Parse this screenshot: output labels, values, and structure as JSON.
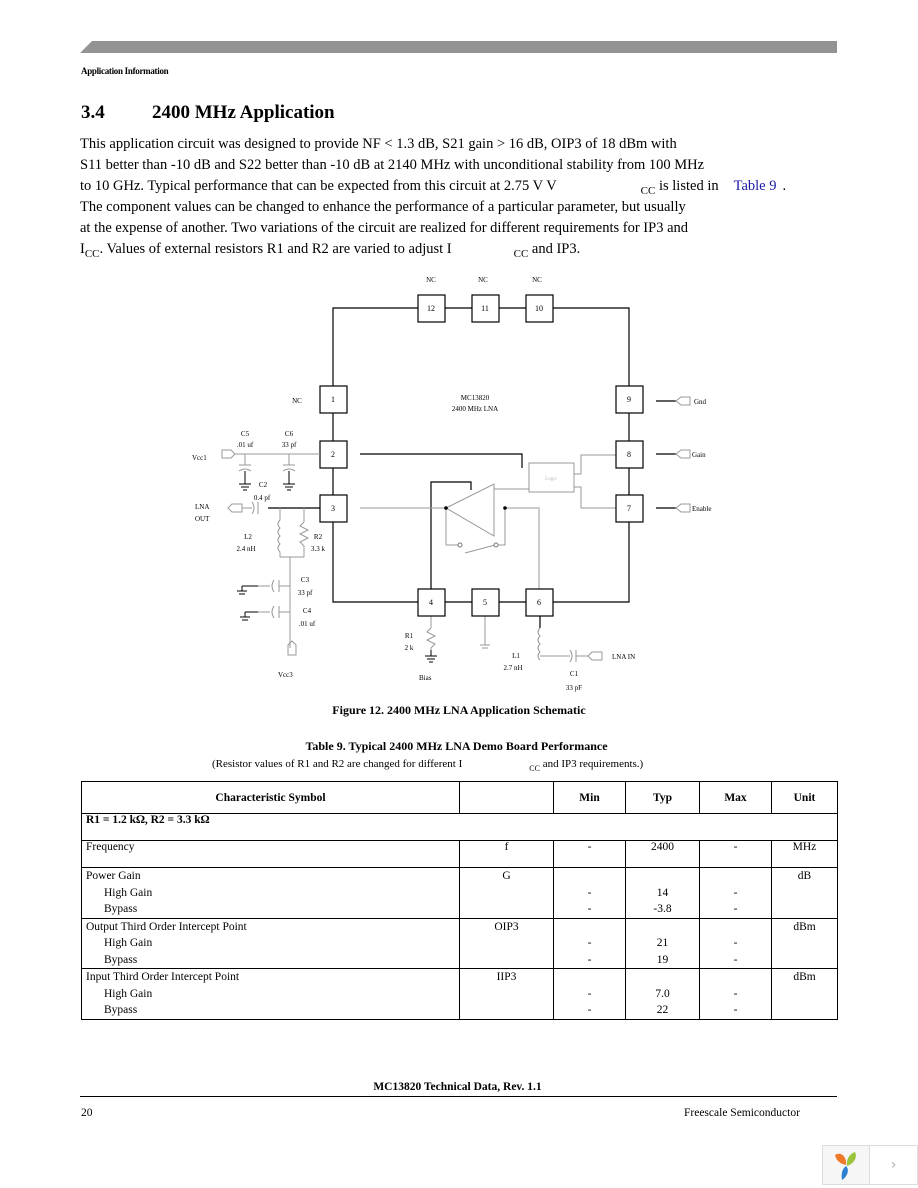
{
  "header": {
    "section_label": "Application Information",
    "bar_color": "#939393"
  },
  "section": {
    "number": "3.4",
    "title": "2400 MHz Application"
  },
  "paragraph": {
    "line1": "This application circuit was designed to provide NF < 1.3 dB, S21 gain > 16 dB, OIP3 of 18 dBm with",
    "line2": "S11 better than -10 dB and S22 better than -10 dB at 2140 MHz with unconditional stability from 100 MHz",
    "line3_a": "to 10 GHz. Typical performance that can be expected from this circuit at 2.75 V V",
    "line3_sub": "CC",
    "line3_b": " is listed in",
    "line3_link": "Table 9",
    "line3_c": ".",
    "line4": "The component values can be changed to enhance the performance of a particular parameter, but usually",
    "line5": "at the expense of another. Two variations of the circuit are realized for different requirements for IP3 and",
    "line6_a": "I",
    "line6_sub": "CC",
    "line6_b": ". Values of external resistors R1 and R2 are varied to adjust I",
    "line6_sub2": "CC",
    "line6_c": " and IP3.",
    "link_color": "#1a1aa6"
  },
  "schematic": {
    "chip_name": "MC13820",
    "chip_desc": "2400 MHz LNA",
    "logic_label": "Logic",
    "pins": [
      "1",
      "2",
      "3",
      "4",
      "5",
      "6",
      "7",
      "8",
      "9",
      "10",
      "11",
      "12"
    ],
    "nc_label": "NC",
    "ports": {
      "vcc1": "Vcc1",
      "vcc3": "Vcc3",
      "lna_out_1": "LNA",
      "lna_out_2": "OUT",
      "lna_in": "LNA IN",
      "gnd": "Gnd",
      "gain": "Gain",
      "enable": "Enable",
      "bias": "Bias"
    },
    "components": {
      "c5_name": "C5",
      "c5_val": ".01 uf",
      "c6_name": "C6",
      "c6_val": "33 pf",
      "c2_name": "C2",
      "c2_val": "0.4 pf",
      "l2_name": "L2",
      "l2_val": "2.4 nH",
      "r2_name": "R2",
      "r2_val": "3.3 k",
      "c3_name": "C3",
      "c3_val": "33 pf",
      "c4_name": "C4",
      "c4_val": ".01 uf",
      "r1_name": "R1",
      "r1_val": "2 k",
      "l1_name": "L1",
      "l1_val": "2.7 nH",
      "c1_name": "C1",
      "c1_val": "33 pF"
    }
  },
  "figure_caption": "Figure 12. 2400 MHz LNA Application Schematic",
  "table": {
    "title": "Table 9. Typical 2400 MHz LNA Demo Board Performance",
    "subtitle_a": "(Resistor values of R1 and R2 are changed for different I",
    "subtitle_sub": "CC",
    "subtitle_b": " and IP3 requirements.)",
    "columns": [
      "Characteristic Symbol",
      "",
      "Min",
      "Typ",
      "Max",
      "Unit"
    ],
    "group_label": "R1 = 1.2 kΩ, R2 = 3.3 kΩ",
    "rows": [
      {
        "characteristic": "Frequency",
        "symbol": "f",
        "min": "-",
        "typ": "2400",
        "max": "-",
        "unit": "MHz"
      },
      {
        "characteristic": "Power Gain",
        "symbol": "G",
        "unit": "dB",
        "sub": [
          {
            "label": "High Gain",
            "min": "-",
            "typ": "14",
            "max": "-"
          },
          {
            "label": "Bypass",
            "min": "-",
            "typ": "-3.8",
            "max": "-"
          }
        ]
      },
      {
        "characteristic": "Output Third Order Intercept Point",
        "symbol": "OIP3",
        "unit": "dBm",
        "sub": [
          {
            "label": "High Gain",
            "min": "-",
            "typ": "21",
            "max": "-"
          },
          {
            "label": "Bypass",
            "min": "-",
            "typ": "19",
            "max": "-"
          }
        ]
      },
      {
        "characteristic": "Input Third Order Intercept Point",
        "symbol": "IIP3",
        "unit": "dBm",
        "sub": [
          {
            "label": "High Gain",
            "min": "-",
            "typ": "7.0",
            "max": "-"
          },
          {
            "label": "Bypass",
            "min": "-",
            "typ": "22",
            "max": "-"
          }
        ]
      }
    ]
  },
  "footer": {
    "doc_title": "MC13820 Technical Data, Rev. 1.1",
    "page_number": "20",
    "company": "Freescale Semiconductor"
  },
  "widget": {
    "logo_icon": "app-logo-icon",
    "next_icon": "chevron-right-icon",
    "next_glyph": "›"
  }
}
